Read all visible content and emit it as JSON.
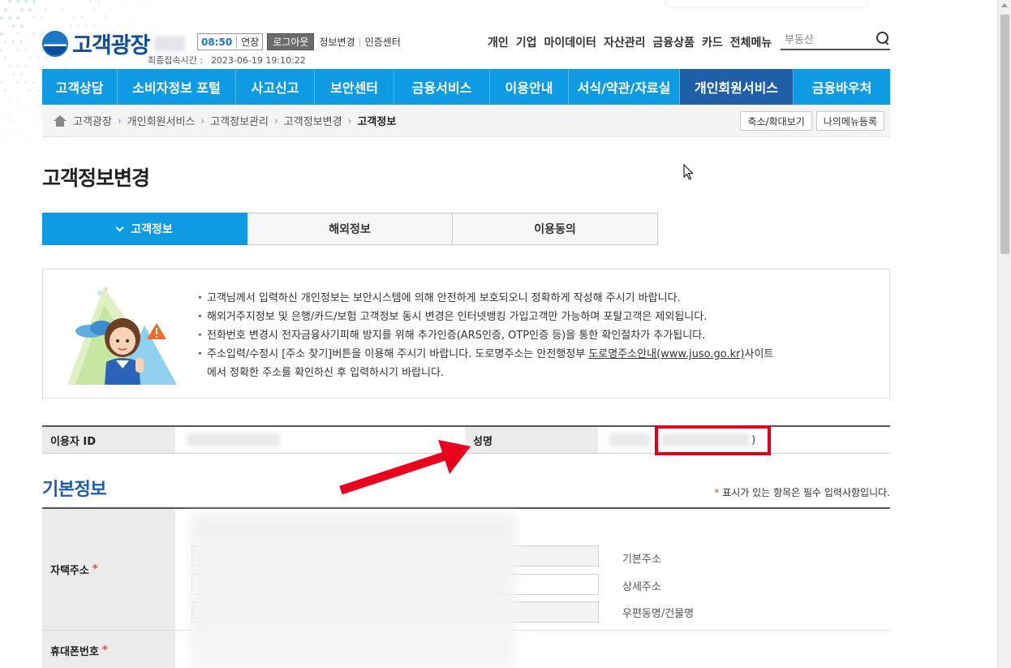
{
  "header": {
    "logo_text": "고객광장",
    "session_time": "08:50",
    "extend_label": "연장",
    "logout_label": "로그아웃",
    "links": [
      "정보변경",
      "인증센터"
    ],
    "last_access_label": "최종접속시간 :",
    "last_access_value": "2023-06-19 19:10:22",
    "gnb": [
      "개인",
      "기업",
      "마이데이터",
      "자산관리",
      "금융상품",
      "카드",
      "전체메뉴"
    ],
    "search_placeholder": "부동산"
  },
  "nav": {
    "items": [
      {
        "label": "고객상담",
        "active": false
      },
      {
        "label": "소비자정보 포털",
        "active": false
      },
      {
        "label": "사고신고",
        "active": false
      },
      {
        "label": "보안센터",
        "active": false
      },
      {
        "label": "금융서비스",
        "active": false
      },
      {
        "label": "이용안내",
        "active": false
      },
      {
        "label": "서식/약관/자료실",
        "active": false
      },
      {
        "label": "개인회원서비스",
        "active": true
      },
      {
        "label": "금융바우처",
        "active": false
      }
    ],
    "accent": "#0e9be3",
    "active_color": "#1e5fa8"
  },
  "breadcrumb": {
    "items": [
      "고객광장",
      "개인회원서비스",
      "고객정보관리",
      "고객정보변경",
      "고객정보"
    ],
    "zoom_button": "축소/확대보기",
    "mymenu_button": "나의메뉴등록"
  },
  "page_title": "고객정보변경",
  "tabs": [
    {
      "label": "고객정보",
      "active": true
    },
    {
      "label": "해외정보",
      "active": false
    },
    {
      "label": "이용동의",
      "active": false
    }
  ],
  "notice": {
    "items": [
      "고객님께서 입력하신 개인정보는 보안시스템에 의해 안전하게 보호되오니 정확하게 작성해 주시기 바랍니다.",
      "해외거주지정보 및 은행/카드/보험 고객정보 동시 변경은 인터넷뱅킹 가입고객만 가능하며 포탈고객은 제외됩니다.",
      "전화번호 변경시 전자금융사기피해 방지를 위해 추가인증(ARS인증, OTP인증 등)을 통한 확인절차가 추가됩니다."
    ],
    "address_pre": "주소입력/수정시 [주소 찾기]버튼을 이용해 주시기 바랍니다. 도로명주소는 안전행정부 ",
    "address_link": "도로명주소안내",
    "address_url": "(www.juso.go.kr)",
    "address_post": "사이트",
    "address_line2": "에서 정확한 주소를 확인하신 후 입력하시기 바랍니다."
  },
  "user_info": {
    "id_label": "이용자 ID",
    "name_label": "성명",
    "name_open": "(",
    "name_close": ")"
  },
  "basic_info": {
    "title": "기본정보",
    "required_note": "표시가 있는 항목은 필수 입력사항입니다.",
    "required_mark": "*",
    "address_label": "자택주소",
    "address_fields": [
      "기본주소",
      "상세주소",
      "우편동명/건물명"
    ],
    "mobile_label": "휴대폰번호"
  }
}
